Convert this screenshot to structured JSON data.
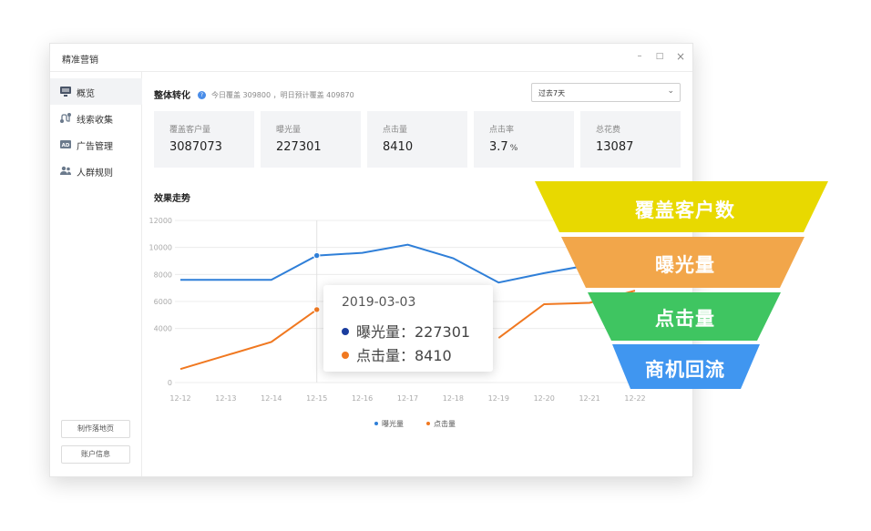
{
  "app": {
    "title": "精准营销"
  },
  "window_controls": {
    "minimize": "–",
    "maximize": "□",
    "close": "×"
  },
  "sidebar": {
    "items": [
      {
        "label": "概览",
        "icon": "monitor-icon",
        "active": true
      },
      {
        "label": "线索收集",
        "icon": "route-icon",
        "active": false
      },
      {
        "label": "广告管理",
        "icon": "ad-icon",
        "active": false
      },
      {
        "label": "人群规则",
        "icon": "people-icon",
        "active": false
      }
    ],
    "buttons": [
      "制作落地页",
      "账户信息"
    ]
  },
  "overview": {
    "title": "整体转化",
    "help": "?",
    "summary": "今日覆盖 309800 ，明日预计覆盖 409870",
    "range_select": "过去7天",
    "metrics": [
      {
        "label": "覆盖客户量",
        "value": "3087073",
        "unit": ""
      },
      {
        "label": "曝光量",
        "value": "227301",
        "unit": ""
      },
      {
        "label": "点击量",
        "value": "8410",
        "unit": ""
      },
      {
        "label": "点击率",
        "value": "3.7",
        "unit": "%"
      },
      {
        "label": "总花费",
        "value": "13087",
        "unit": ""
      }
    ]
  },
  "trend": {
    "title": "效果走势"
  },
  "chart_data": {
    "type": "line",
    "categories": [
      "12-12",
      "12-13",
      "12-14",
      "12-15",
      "12-16",
      "12-17",
      "12-18",
      "12-19",
      "12-20",
      "12-21",
      "12-22"
    ],
    "series": [
      {
        "name": "曝光量",
        "color": "#2f7fd8",
        "values": [
          7600,
          7600,
          7600,
          9400,
          9600,
          10200,
          9200,
          7400,
          8100,
          8700,
          9100
        ]
      },
      {
        "name": "点击量",
        "color": "#f07820",
        "values": [
          1000,
          2000,
          3000,
          5400,
          null,
          null,
          null,
          3300,
          5800,
          5900,
          6800
        ]
      }
    ],
    "yticks": [
      0,
      4000,
      6000,
      8000,
      10000,
      12000
    ],
    "ylim": [
      0,
      12000
    ],
    "highlight_index": 3,
    "legend_position": "bottom",
    "grid": true
  },
  "tooltip": {
    "date": "2019-03-03",
    "rows": [
      {
        "label": "曝光量：227301",
        "color": "#1a3d9e"
      },
      {
        "label": "点击量：8410",
        "color": "#f07820"
      }
    ]
  },
  "funnel": {
    "levels": [
      {
        "label": "覆盖客户数",
        "color": "#e8d900"
      },
      {
        "label": "曝光量",
        "color": "#f2a64a"
      },
      {
        "label": "点击量",
        "color": "#3fc561"
      },
      {
        "label": "商机回流",
        "color": "#4096f0"
      }
    ]
  }
}
